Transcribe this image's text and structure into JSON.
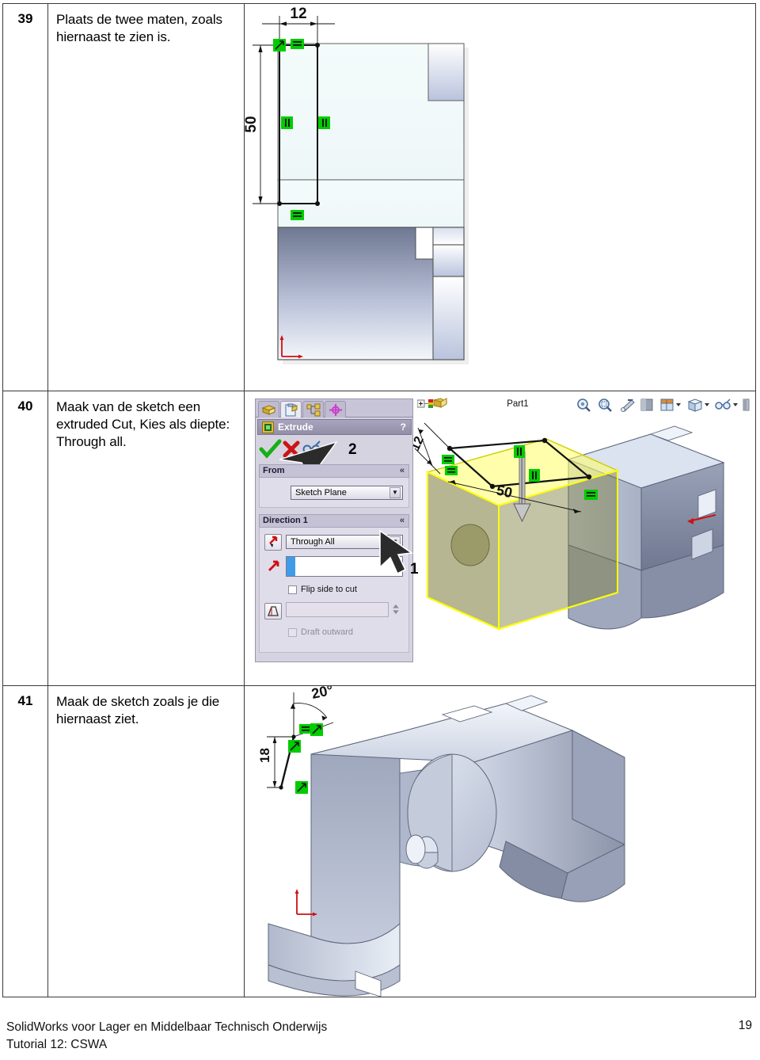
{
  "document": {
    "steps": [
      {
        "number": "39",
        "text": "Plaats de twee maten, zoals hiernaast te zien is.",
        "figure": "sketch-dimensions-front-view"
      },
      {
        "number": "40",
        "text": "Maak van de sketch een extruded Cut, Kies als diepte: Through all.",
        "figure": "solidworks-extrude-propertymanager"
      },
      {
        "number": "41",
        "text": "Maak de sketch zoals je die hiernaast ziet.",
        "figure": "bracket-sketch-angle"
      }
    ]
  },
  "figure39": {
    "dim_width": "12",
    "dim_height": "50",
    "relations": [
      "equal",
      "equal",
      "parallel",
      "parallel",
      "coincident"
    ]
  },
  "figure40": {
    "panel": {
      "title": "Extrude",
      "help": "?",
      "tabs": [
        "feature-manager-tab",
        "property-manager-tab",
        "configuration-manager-tab",
        "dimxpert-manager-tab"
      ],
      "ok_label": "accept",
      "cancel_label": "cancel",
      "preview_label": "detailed-preview",
      "groups": [
        {
          "name": "From",
          "collapse": "«",
          "start_condition": "Sketch Plane"
        },
        {
          "name": "Direction 1",
          "collapse": "«",
          "end_condition": "Through All",
          "flip_side_to_cut": "Flip side to cut",
          "draft_outward": "Draft outward",
          "depth_value": ""
        }
      ]
    },
    "tree_root": "Part1",
    "toolbar_icons": [
      "zoom-to-fit-icon",
      "zoom-to-area-icon",
      "previous-view-icon",
      "section-view-icon",
      "view-orientation-icon",
      "display-style-icon",
      "hide-show-items-icon",
      "appearance-icon"
    ],
    "callouts": {
      "one": "1",
      "two": "2"
    },
    "model_dims": {
      "width": "12",
      "height": "50"
    },
    "colors": {
      "preview_yellow": "#ffff00",
      "panel_bg": "#d6d3e0",
      "title_bar": "#928ea8",
      "relation_green": "#00cc00",
      "model_grey": "#8c93ad"
    }
  },
  "figure41": {
    "dim_angle": "20°",
    "dim_length": "18",
    "relations": [
      "equal",
      "coincident",
      "coincident",
      "coincident"
    ]
  },
  "footer": {
    "line1": "SolidWorks voor Lager en Middelbaar Technisch Onderwijs",
    "line2": "Tutorial 12: CSWA",
    "page_number": "19"
  }
}
